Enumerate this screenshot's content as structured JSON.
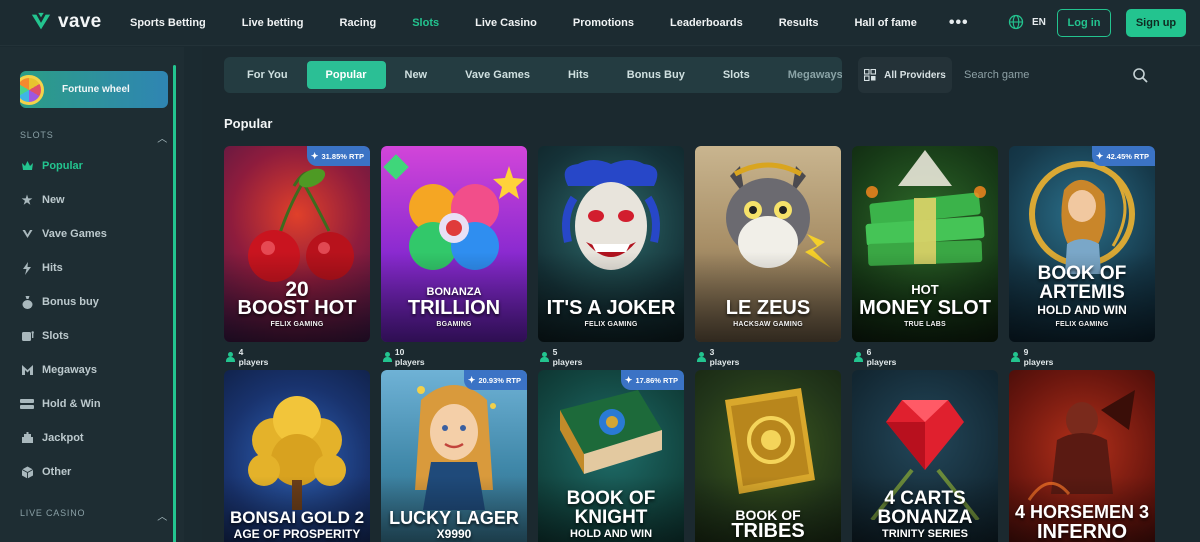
{
  "brand": {
    "name": "vave"
  },
  "nav": {
    "items": [
      "Sports Betting",
      "Live betting",
      "Racing",
      "Slots",
      "Live Casino",
      "Promotions",
      "Leaderboards",
      "Results",
      "Hall of fame"
    ],
    "active": "Slots",
    "more_icon": "ellipsis-icon",
    "language": "EN",
    "login_label": "Log in",
    "signup_label": "Sign up"
  },
  "colors": {
    "accent": "#23c48f",
    "rtp_badge": "#3b73c5",
    "background": "#1b2a30"
  },
  "sidebar": {
    "promo_label": "Fortune wheel",
    "slots_heading": "SLOTS",
    "items": [
      {
        "label": "Popular",
        "icon": "crown-icon",
        "active": true
      },
      {
        "label": "New",
        "icon": "star-icon"
      },
      {
        "label": "Vave Games",
        "icon": "vave-logo-icon"
      },
      {
        "label": "Hits",
        "icon": "lightning-icon"
      },
      {
        "label": "Bonus buy",
        "icon": "money-bag-icon"
      },
      {
        "label": "Slots",
        "icon": "slot-machine-icon"
      },
      {
        "label": "Megaways",
        "icon": "megaways-icon"
      },
      {
        "label": "Hold & Win",
        "icon": "hold-win-icon"
      },
      {
        "label": "Jackpot",
        "icon": "jackpot-icon"
      },
      {
        "label": "Other",
        "icon": "cube-icon"
      }
    ],
    "live_heading": "LIVE CASINO"
  },
  "tabs": {
    "items": [
      "For You",
      "Popular",
      "New",
      "Vave Games",
      "Hits",
      "Bonus Buy",
      "Slots",
      "Megaways"
    ],
    "active": "Popular"
  },
  "providers_label": "All Providers",
  "search": {
    "placeholder": "Search game"
  },
  "section_title": "Popular",
  "games": [
    {
      "line1": "20",
      "line2": "BOOST HOT",
      "maker": "FELIX GAMING",
      "rtp": "31.85% RTP",
      "players": "4 players"
    },
    {
      "line1": "BONANZA",
      "line2": "TRILLION",
      "maker": "BGAMING",
      "players": "10 players"
    },
    {
      "line1": "",
      "line2": "IT'S A JOKER",
      "maker": "FELIX GAMING",
      "players": "5 players"
    },
    {
      "line1": "",
      "line2": "LE ZEUS",
      "maker": "HACKSAW GAMING",
      "players": "3 players"
    },
    {
      "line1": "HOT",
      "line2": "MONEY SLOT",
      "maker": "TRUE LABS",
      "players": "6 players"
    },
    {
      "line1": "BOOK OF",
      "line2": "ARTEMIS",
      "line3": "HOLD AND WIN",
      "maker": "FELIX GAMING",
      "rtp": "42.45% RTP",
      "players": "9 players"
    },
    {
      "line1": "BONSAI GOLD 2",
      "line2": "AGE OF PROSPERITY"
    },
    {
      "line1": "LUCKY LAGER",
      "line2": "X9990",
      "rtp": "20.93% RTP"
    },
    {
      "line1": "BOOK OF",
      "line2": "KNIGHT",
      "line3": "HOLD AND WIN",
      "rtp": "17.86% RTP"
    },
    {
      "line1": "BOOK OF",
      "line2": "TRIBES"
    },
    {
      "line1": "4 CARTS",
      "line2": "BONANZA",
      "line3": "TRINITY SERIES"
    },
    {
      "line1": "4 HORSEMEN 3",
      "line2": "INFERNO"
    }
  ]
}
